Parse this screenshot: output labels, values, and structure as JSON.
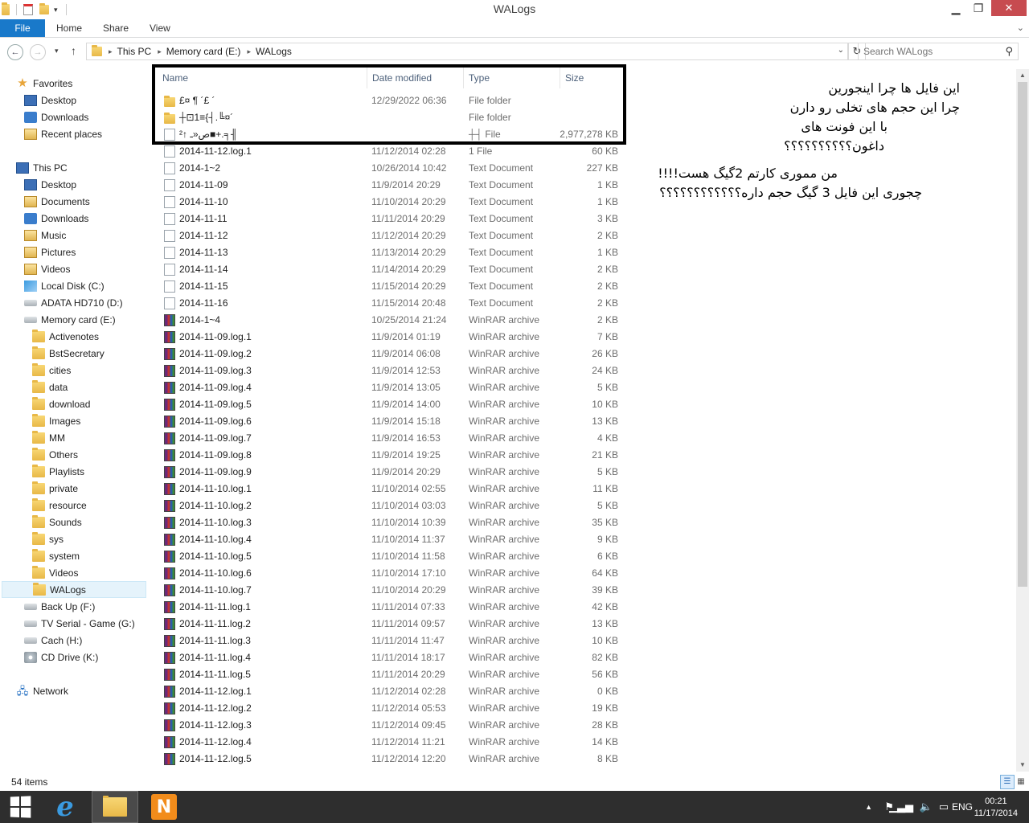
{
  "window": {
    "title": "WALogs"
  },
  "ribbon": {
    "tabs": [
      "File",
      "Home",
      "Share",
      "View"
    ]
  },
  "address": {
    "crumbs": [
      "This PC",
      "Memory card (E:)",
      "WALogs"
    ],
    "search_placeholder": "Search WALogs"
  },
  "nav": {
    "favorites_label": "Favorites",
    "favorites": [
      "Desktop",
      "Downloads",
      "Recent places"
    ],
    "thispc_label": "This PC",
    "thispc": [
      "Desktop",
      "Documents",
      "Downloads",
      "Music",
      "Pictures",
      "Videos",
      "Local Disk (C:)",
      "ADATA HD710 (D:)",
      "Memory card (E:)"
    ],
    "memcard_folders": [
      "Activenotes",
      "BstSecretary",
      "cities",
      "data",
      "download",
      "Images",
      "MM",
      "Others",
      "Playlists",
      "private",
      "resource",
      "Sounds",
      "sys",
      "system",
      "Videos",
      "WALogs"
    ],
    "drives_after": [
      "Back Up (F:)",
      "TV Serial - Game (G:)",
      "Cach (H:)",
      "CD Drive (K:)"
    ],
    "network_label": "Network"
  },
  "columns": {
    "name": "Name",
    "date": "Date modified",
    "type": "Type",
    "size": "Size"
  },
  "files": [
    {
      "name": "£¤  ¶ ´£  ´",
      "date": "12/29/2022 06:36",
      "type": "File folder",
      "size": "",
      "icon": "folder"
    },
    {
      "name": "┼⊡1≡{┤.╚¤´",
      "date": "",
      "type": "File folder",
      "size": "",
      "icon": "folder"
    },
    {
      "name": "ص«ـ  ↑²■+.╕╢",
      "date": "",
      "type": "┼┤ File",
      "size": "2,977,278 KB",
      "icon": "doc"
    },
    {
      "name": "2014-11-12.log.1",
      "date": "11/12/2014 02:28",
      "type": "1 File",
      "size": "60 KB",
      "icon": "doc"
    },
    {
      "name": "2014-1~2",
      "date": "10/26/2014 10:42",
      "type": "Text Document",
      "size": "227 KB",
      "icon": "doc"
    },
    {
      "name": "2014-11-09",
      "date": "11/9/2014 20:29",
      "type": "Text Document",
      "size": "1 KB",
      "icon": "doc"
    },
    {
      "name": "2014-11-10",
      "date": "11/10/2014 20:29",
      "type": "Text Document",
      "size": "1 KB",
      "icon": "doc"
    },
    {
      "name": "2014-11-11",
      "date": "11/11/2014 20:29",
      "type": "Text Document",
      "size": "3 KB",
      "icon": "doc"
    },
    {
      "name": "2014-11-12",
      "date": "11/12/2014 20:29",
      "type": "Text Document",
      "size": "2 KB",
      "icon": "doc"
    },
    {
      "name": "2014-11-13",
      "date": "11/13/2014 20:29",
      "type": "Text Document",
      "size": "1 KB",
      "icon": "doc"
    },
    {
      "name": "2014-11-14",
      "date": "11/14/2014 20:29",
      "type": "Text Document",
      "size": "2 KB",
      "icon": "doc"
    },
    {
      "name": "2014-11-15",
      "date": "11/15/2014 20:29",
      "type": "Text Document",
      "size": "2 KB",
      "icon": "doc"
    },
    {
      "name": "2014-11-16",
      "date": "11/15/2014 20:48",
      "type": "Text Document",
      "size": "2 KB",
      "icon": "doc"
    },
    {
      "name": "2014-1~4",
      "date": "10/25/2014 21:24",
      "type": "WinRAR archive",
      "size": "2 KB",
      "icon": "rar"
    },
    {
      "name": "2014-11-09.log.1",
      "date": "11/9/2014 01:19",
      "type": "WinRAR archive",
      "size": "7 KB",
      "icon": "rar"
    },
    {
      "name": "2014-11-09.log.2",
      "date": "11/9/2014 06:08",
      "type": "WinRAR archive",
      "size": "26 KB",
      "icon": "rar"
    },
    {
      "name": "2014-11-09.log.3",
      "date": "11/9/2014 12:53",
      "type": "WinRAR archive",
      "size": "24 KB",
      "icon": "rar"
    },
    {
      "name": "2014-11-09.log.4",
      "date": "11/9/2014 13:05",
      "type": "WinRAR archive",
      "size": "5 KB",
      "icon": "rar"
    },
    {
      "name": "2014-11-09.log.5",
      "date": "11/9/2014 14:00",
      "type": "WinRAR archive",
      "size": "10 KB",
      "icon": "rar"
    },
    {
      "name": "2014-11-09.log.6",
      "date": "11/9/2014 15:18",
      "type": "WinRAR archive",
      "size": "13 KB",
      "icon": "rar"
    },
    {
      "name": "2014-11-09.log.7",
      "date": "11/9/2014 16:53",
      "type": "WinRAR archive",
      "size": "4 KB",
      "icon": "rar"
    },
    {
      "name": "2014-11-09.log.8",
      "date": "11/9/2014 19:25",
      "type": "WinRAR archive",
      "size": "21 KB",
      "icon": "rar"
    },
    {
      "name": "2014-11-09.log.9",
      "date": "11/9/2014 20:29",
      "type": "WinRAR archive",
      "size": "5 KB",
      "icon": "rar"
    },
    {
      "name": "2014-11-10.log.1",
      "date": "11/10/2014 02:55",
      "type": "WinRAR archive",
      "size": "11 KB",
      "icon": "rar"
    },
    {
      "name": "2014-11-10.log.2",
      "date": "11/10/2014 03:03",
      "type": "WinRAR archive",
      "size": "5 KB",
      "icon": "rar"
    },
    {
      "name": "2014-11-10.log.3",
      "date": "11/10/2014 10:39",
      "type": "WinRAR archive",
      "size": "35 KB",
      "icon": "rar"
    },
    {
      "name": "2014-11-10.log.4",
      "date": "11/10/2014 11:37",
      "type": "WinRAR archive",
      "size": "9 KB",
      "icon": "rar"
    },
    {
      "name": "2014-11-10.log.5",
      "date": "11/10/2014 11:58",
      "type": "WinRAR archive",
      "size": "6 KB",
      "icon": "rar"
    },
    {
      "name": "2014-11-10.log.6",
      "date": "11/10/2014 17:10",
      "type": "WinRAR archive",
      "size": "64 KB",
      "icon": "rar"
    },
    {
      "name": "2014-11-10.log.7",
      "date": "11/10/2014 20:29",
      "type": "WinRAR archive",
      "size": "39 KB",
      "icon": "rar"
    },
    {
      "name": "2014-11-11.log.1",
      "date": "11/11/2014 07:33",
      "type": "WinRAR archive",
      "size": "42 KB",
      "icon": "rar"
    },
    {
      "name": "2014-11-11.log.2",
      "date": "11/11/2014 09:57",
      "type": "WinRAR archive",
      "size": "13 KB",
      "icon": "rar"
    },
    {
      "name": "2014-11-11.log.3",
      "date": "11/11/2014 11:47",
      "type": "WinRAR archive",
      "size": "10 KB",
      "icon": "rar"
    },
    {
      "name": "2014-11-11.log.4",
      "date": "11/11/2014 18:17",
      "type": "WinRAR archive",
      "size": "82 KB",
      "icon": "rar"
    },
    {
      "name": "2014-11-11.log.5",
      "date": "11/11/2014 20:29",
      "type": "WinRAR archive",
      "size": "56 KB",
      "icon": "rar"
    },
    {
      "name": "2014-11-12.log.1",
      "date": "11/12/2014 02:28",
      "type": "WinRAR archive",
      "size": "0 KB",
      "icon": "rar"
    },
    {
      "name": "2014-11-12.log.2",
      "date": "11/12/2014 05:53",
      "type": "WinRAR archive",
      "size": "19 KB",
      "icon": "rar"
    },
    {
      "name": "2014-11-12.log.3",
      "date": "11/12/2014 09:45",
      "type": "WinRAR archive",
      "size": "28 KB",
      "icon": "rar"
    },
    {
      "name": "2014-11-12.log.4",
      "date": "11/12/2014 11:21",
      "type": "WinRAR archive",
      "size": "14 KB",
      "icon": "rar"
    },
    {
      "name": "2014-11-12.log.5",
      "date": "11/12/2014 12:20",
      "type": "WinRAR archive",
      "size": "8 KB",
      "icon": "rar"
    }
  ],
  "annotations": {
    "top": [
      "این فایل ها چرا اینجورین",
      "چرا این حجم های تخلی رو دارن",
      "با این فونت های",
      "داغون؟؟؟؟؟؟؟؟؟؟"
    ],
    "bottom": [
      "من مموری کارتم 2گیگ هست!!!!",
      "چجوری این فایل 3 گیگ حجم داره؟؟؟؟؟؟؟؟؟؟؟؟"
    ]
  },
  "status": {
    "items": "54 items"
  },
  "taskbar": {
    "lang": "ENG",
    "time": "00:21",
    "date": "11/17/2014",
    "n_app_letter": "N"
  },
  "colors": {
    "file_tab": "#1979ca",
    "close_button": "#c74b50",
    "taskbar": "#2e2e2e",
    "selection": "#e5f3fb"
  }
}
